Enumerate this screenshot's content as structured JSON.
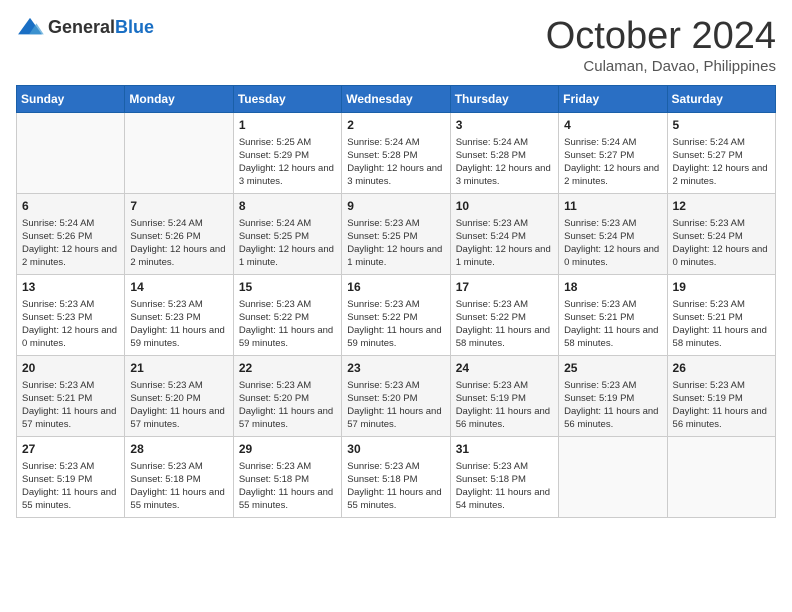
{
  "logo": {
    "text_general": "General",
    "text_blue": "Blue"
  },
  "title": {
    "month": "October 2024",
    "location": "Culaman, Davao, Philippines"
  },
  "headers": [
    "Sunday",
    "Monday",
    "Tuesday",
    "Wednesday",
    "Thursday",
    "Friday",
    "Saturday"
  ],
  "weeks": [
    [
      {
        "day": "",
        "info": ""
      },
      {
        "day": "",
        "info": ""
      },
      {
        "day": "1",
        "info": "Sunrise: 5:25 AM\nSunset: 5:29 PM\nDaylight: 12 hours and 3 minutes."
      },
      {
        "day": "2",
        "info": "Sunrise: 5:24 AM\nSunset: 5:28 PM\nDaylight: 12 hours and 3 minutes."
      },
      {
        "day": "3",
        "info": "Sunrise: 5:24 AM\nSunset: 5:28 PM\nDaylight: 12 hours and 3 minutes."
      },
      {
        "day": "4",
        "info": "Sunrise: 5:24 AM\nSunset: 5:27 PM\nDaylight: 12 hours and 2 minutes."
      },
      {
        "day": "5",
        "info": "Sunrise: 5:24 AM\nSunset: 5:27 PM\nDaylight: 12 hours and 2 minutes."
      }
    ],
    [
      {
        "day": "6",
        "info": "Sunrise: 5:24 AM\nSunset: 5:26 PM\nDaylight: 12 hours and 2 minutes."
      },
      {
        "day": "7",
        "info": "Sunrise: 5:24 AM\nSunset: 5:26 PM\nDaylight: 12 hours and 2 minutes."
      },
      {
        "day": "8",
        "info": "Sunrise: 5:24 AM\nSunset: 5:25 PM\nDaylight: 12 hours and 1 minute."
      },
      {
        "day": "9",
        "info": "Sunrise: 5:23 AM\nSunset: 5:25 PM\nDaylight: 12 hours and 1 minute."
      },
      {
        "day": "10",
        "info": "Sunrise: 5:23 AM\nSunset: 5:24 PM\nDaylight: 12 hours and 1 minute."
      },
      {
        "day": "11",
        "info": "Sunrise: 5:23 AM\nSunset: 5:24 PM\nDaylight: 12 hours and 0 minutes."
      },
      {
        "day": "12",
        "info": "Sunrise: 5:23 AM\nSunset: 5:24 PM\nDaylight: 12 hours and 0 minutes."
      }
    ],
    [
      {
        "day": "13",
        "info": "Sunrise: 5:23 AM\nSunset: 5:23 PM\nDaylight: 12 hours and 0 minutes."
      },
      {
        "day": "14",
        "info": "Sunrise: 5:23 AM\nSunset: 5:23 PM\nDaylight: 11 hours and 59 minutes."
      },
      {
        "day": "15",
        "info": "Sunrise: 5:23 AM\nSunset: 5:22 PM\nDaylight: 11 hours and 59 minutes."
      },
      {
        "day": "16",
        "info": "Sunrise: 5:23 AM\nSunset: 5:22 PM\nDaylight: 11 hours and 59 minutes."
      },
      {
        "day": "17",
        "info": "Sunrise: 5:23 AM\nSunset: 5:22 PM\nDaylight: 11 hours and 58 minutes."
      },
      {
        "day": "18",
        "info": "Sunrise: 5:23 AM\nSunset: 5:21 PM\nDaylight: 11 hours and 58 minutes."
      },
      {
        "day": "19",
        "info": "Sunrise: 5:23 AM\nSunset: 5:21 PM\nDaylight: 11 hours and 58 minutes."
      }
    ],
    [
      {
        "day": "20",
        "info": "Sunrise: 5:23 AM\nSunset: 5:21 PM\nDaylight: 11 hours and 57 minutes."
      },
      {
        "day": "21",
        "info": "Sunrise: 5:23 AM\nSunset: 5:20 PM\nDaylight: 11 hours and 57 minutes."
      },
      {
        "day": "22",
        "info": "Sunrise: 5:23 AM\nSunset: 5:20 PM\nDaylight: 11 hours and 57 minutes."
      },
      {
        "day": "23",
        "info": "Sunrise: 5:23 AM\nSunset: 5:20 PM\nDaylight: 11 hours and 57 minutes."
      },
      {
        "day": "24",
        "info": "Sunrise: 5:23 AM\nSunset: 5:19 PM\nDaylight: 11 hours and 56 minutes."
      },
      {
        "day": "25",
        "info": "Sunrise: 5:23 AM\nSunset: 5:19 PM\nDaylight: 11 hours and 56 minutes."
      },
      {
        "day": "26",
        "info": "Sunrise: 5:23 AM\nSunset: 5:19 PM\nDaylight: 11 hours and 56 minutes."
      }
    ],
    [
      {
        "day": "27",
        "info": "Sunrise: 5:23 AM\nSunset: 5:19 PM\nDaylight: 11 hours and 55 minutes."
      },
      {
        "day": "28",
        "info": "Sunrise: 5:23 AM\nSunset: 5:18 PM\nDaylight: 11 hours and 55 minutes."
      },
      {
        "day": "29",
        "info": "Sunrise: 5:23 AM\nSunset: 5:18 PM\nDaylight: 11 hours and 55 minutes."
      },
      {
        "day": "30",
        "info": "Sunrise: 5:23 AM\nSunset: 5:18 PM\nDaylight: 11 hours and 55 minutes."
      },
      {
        "day": "31",
        "info": "Sunrise: 5:23 AM\nSunset: 5:18 PM\nDaylight: 11 hours and 54 minutes."
      },
      {
        "day": "",
        "info": ""
      },
      {
        "day": "",
        "info": ""
      }
    ]
  ]
}
